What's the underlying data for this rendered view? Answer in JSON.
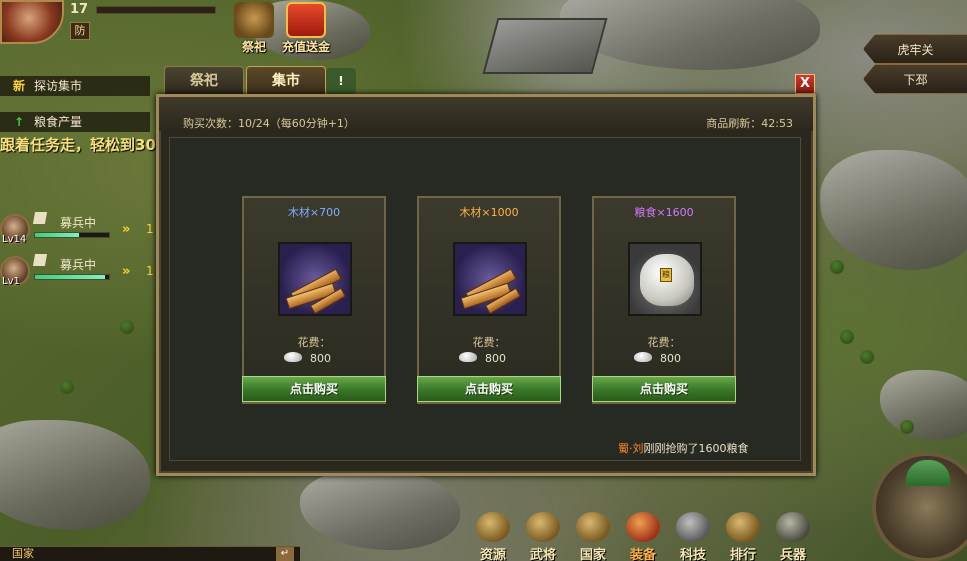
{
  "player": {
    "level": "17",
    "defense_badge": "防"
  },
  "top_icons": [
    {
      "label": "祭祀",
      "icon": "cauldron-icon"
    },
    {
      "label": "充值送金",
      "icon": "gift-box-icon"
    }
  ],
  "quests": [
    {
      "icon": "新",
      "label": "探访集市"
    },
    {
      "icon": "↑",
      "label": "粮食产量"
    }
  ],
  "marquee": "跟着任务走，轻松到30",
  "recruits": [
    {
      "level": "Lv14",
      "status": "募兵中",
      "progress": 0.6,
      "arrows": "»",
      "count": "1"
    },
    {
      "level": "Lv1",
      "status": "募兵中",
      "progress": 0.95,
      "arrows": "»",
      "count": "1"
    }
  ],
  "city_nav": [
    "虎牢关",
    "下邳"
  ],
  "dialog": {
    "tabs": [
      "祭祀",
      "集市"
    ],
    "active_tab": "集市",
    "extra_tab_glyph": "!",
    "close_label": "X",
    "buy_count": "购买次数：10/24（每60分钟+1）",
    "refresh": "商品刷新：42:53",
    "items": [
      {
        "title": "木材×700",
        "title_color": "#7ab0ff",
        "icon": "wood-planks-icon",
        "cost_label": "花费：",
        "price": "800",
        "button": "点击购买"
      },
      {
        "title": "木材×1000",
        "title_color": "#ffb24a",
        "icon": "wood-planks-icon",
        "cost_label": "花费：",
        "price": "800",
        "button": "点击购买"
      },
      {
        "title": "粮食×1600",
        "title_color": "#d27aff",
        "icon": "grain-sack-icon",
        "cost_label": "花费：",
        "price": "800",
        "button": "点击购买"
      }
    ],
    "sack_tag": "粮",
    "broadcast_who": "蜀·刘",
    "broadcast_text": "刚刚抢购了1600粮食"
  },
  "chat": {
    "channel": "国家",
    "send": "↵"
  },
  "bottom_menu": [
    "资源",
    "武将",
    "国家",
    "装备",
    "科技",
    "排行",
    "兵器"
  ]
}
